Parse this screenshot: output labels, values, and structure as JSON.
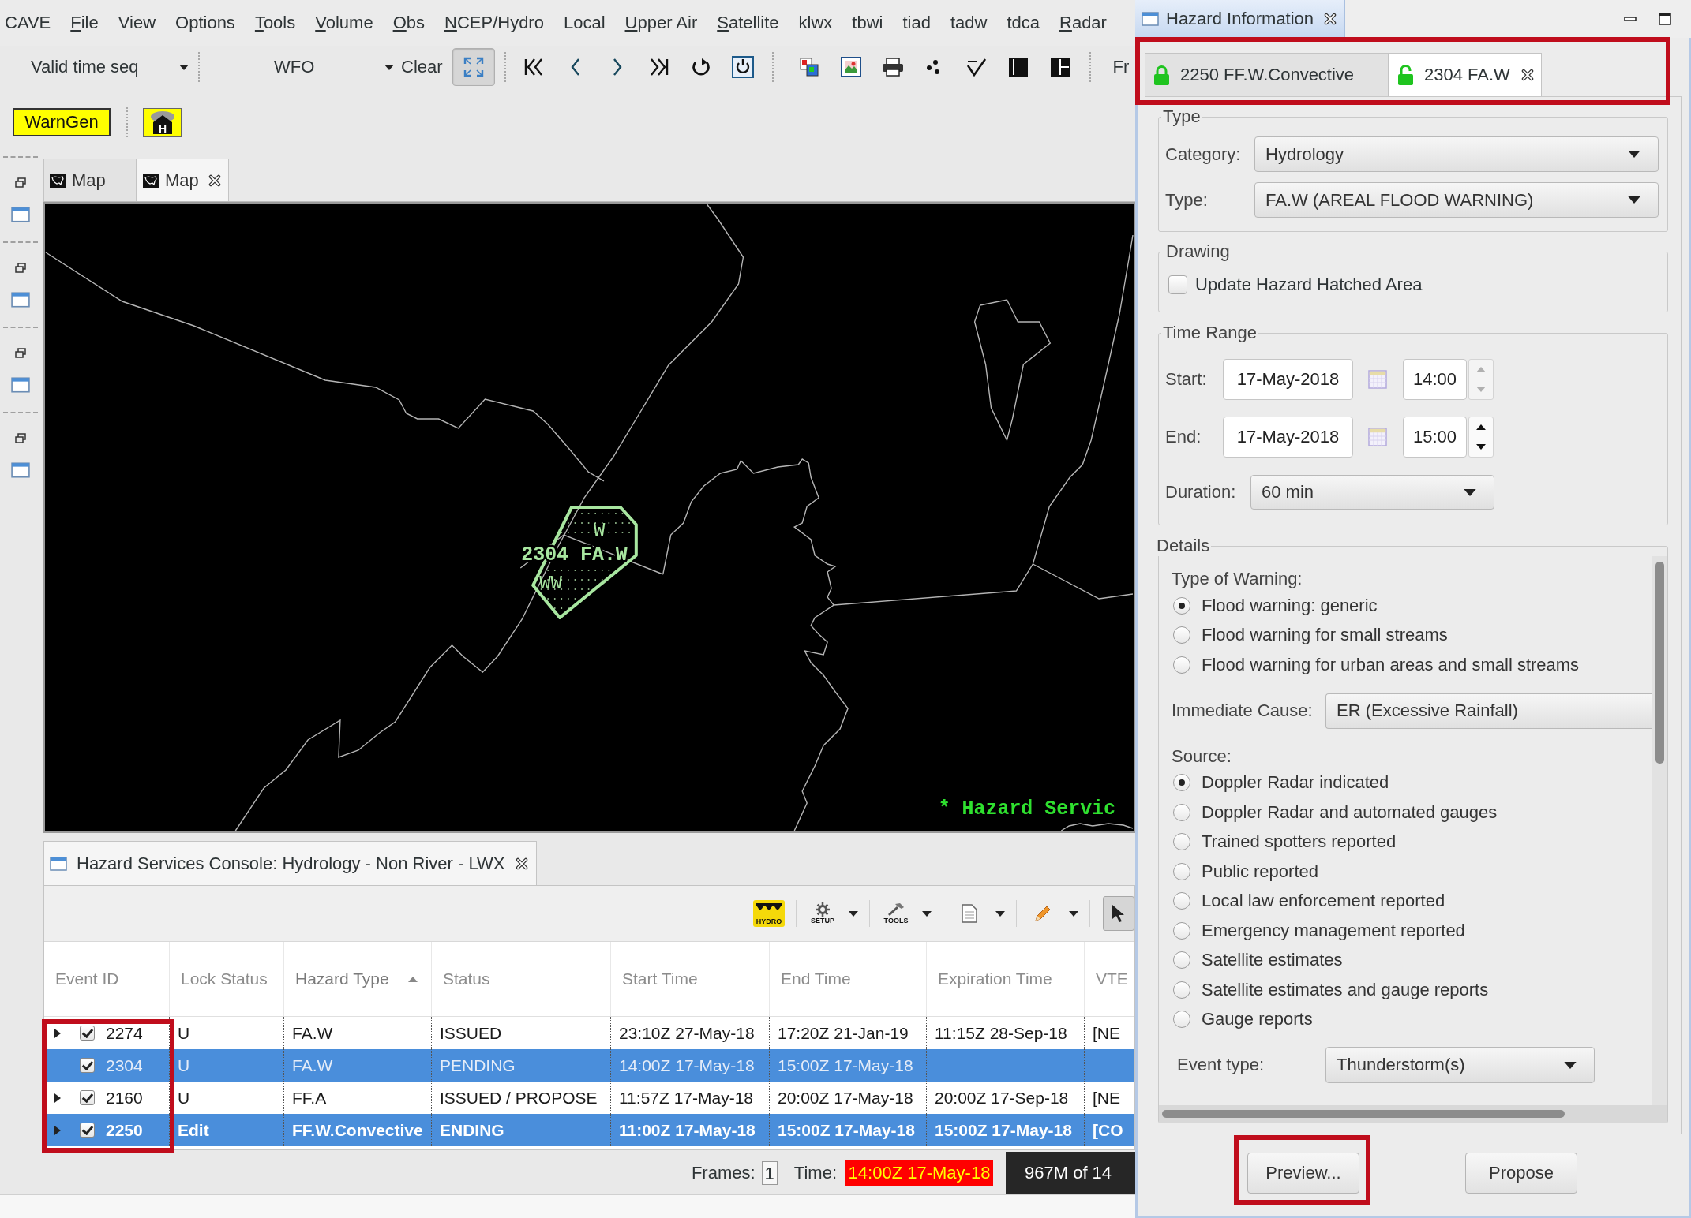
{
  "menu": [
    {
      "label": "CAVE",
      "mnemonic": false
    },
    {
      "label": "File",
      "mnemonic": true
    },
    {
      "label": "View",
      "mnemonic": false
    },
    {
      "label": "Options",
      "mnemonic": false
    },
    {
      "label": "Tools",
      "mnemonic": true
    },
    {
      "label": "Volume",
      "mnemonic": true
    },
    {
      "label": "Obs",
      "mnemonic": true
    },
    {
      "label": "NCEP/Hydro",
      "mnemonic": true
    },
    {
      "label": "Local",
      "mnemonic": false
    },
    {
      "label": "Upper Air",
      "mnemonic": true
    },
    {
      "label": "Satellite",
      "mnemonic": true
    },
    {
      "label": "klwx",
      "mnemonic": false
    },
    {
      "label": "tbwi",
      "mnemonic": false
    },
    {
      "label": "tiad",
      "mnemonic": false
    },
    {
      "label": "tadw",
      "mnemonic": false
    },
    {
      "label": "tdca",
      "mnemonic": false
    },
    {
      "label": "Radar",
      "mnemonic": true
    }
  ],
  "toolbar": {
    "time_mode": "Valid time seq",
    "scale": "WFO",
    "clear": "Clear",
    "extent_pressed": true,
    "overflow_label": "Fr"
  },
  "tools_bar": {
    "warngen": "WarnGen",
    "hazard_glyph": "H"
  },
  "editor_tabs": [
    {
      "label": "Map",
      "selected": false
    },
    {
      "label": "Map",
      "selected": true
    }
  ],
  "map": {
    "hazard_label": "2304 FA.W",
    "hatch_marks": [
      "W",
      "WW"
    ],
    "legend": "* Hazard Servic"
  },
  "console": {
    "title": "Hazard Services Console: Hydrology - Non River - LWX",
    "toolbar": [
      {
        "kind": "hydro",
        "label": "HYDRO",
        "menu": false,
        "pressed": false
      },
      {
        "kind": "setup",
        "label": "SETUP",
        "menu": true,
        "pressed": false
      },
      {
        "kind": "tools",
        "label": "TOOLS",
        "menu": true,
        "pressed": false
      },
      {
        "kind": "document",
        "menu": true,
        "pressed": false
      },
      {
        "kind": "pencil",
        "menu": true,
        "pressed": false
      },
      {
        "kind": "pointer",
        "menu": false,
        "pressed": true
      }
    ],
    "columns": [
      {
        "label": "Event ID",
        "sorted": false
      },
      {
        "label": "Lock Status",
        "sorted": false
      },
      {
        "label": "Hazard Type",
        "sorted": true
      },
      {
        "label": "Status",
        "sorted": false
      },
      {
        "label": "Start Time",
        "sorted": false
      },
      {
        "label": "End Time",
        "sorted": false
      },
      {
        "label": "Expiration Time",
        "sorted": false
      },
      {
        "label": "VTE",
        "sorted": false
      }
    ],
    "rows": [
      {
        "expandable": true,
        "checked": true,
        "selected": false,
        "bold": false,
        "cells": [
          "2274",
          "U",
          "FA.W",
          "ISSUED",
          "23:10Z 27-May-18",
          "17:20Z 21-Jan-19",
          "11:15Z 28-Sep-18",
          "[NE"
        ]
      },
      {
        "expandable": false,
        "checked": true,
        "selected": true,
        "bold": false,
        "cells": [
          "2304",
          "U",
          "FA.W",
          "PENDING",
          "14:00Z 17-May-18",
          "15:00Z 17-May-18"
        ]
      },
      {
        "expandable": true,
        "checked": true,
        "selected": false,
        "bold": false,
        "cells": [
          "2160",
          "U",
          "FF.A",
          "ISSUED / PROPOSE",
          "11:57Z 17-May-18",
          "20:00Z 17-May-18",
          "20:00Z 17-Sep-18",
          "[NE"
        ]
      },
      {
        "expandable": true,
        "checked": true,
        "selected": true,
        "bold": true,
        "cells": [
          "2250",
          "Edit",
          "FF.W.Convective",
          "ENDING",
          "11:00Z 17-May-18",
          "15:00Z 17-May-18",
          "15:00Z 17-May-18",
          "[CO"
        ]
      }
    ],
    "event_ids_highlighted": true
  },
  "status_bar": {
    "frames_label": "Frames:",
    "frames": "1",
    "time_label": "Time:",
    "time": "14:00Z 17-May-18",
    "memory": "967M of 14"
  },
  "hazard_information": {
    "title": "Hazard Information",
    "tabs": [
      {
        "label": "2250 FF.W.Convective",
        "locked": true,
        "selected": false,
        "closable": false
      },
      {
        "label": "2304 FA.W",
        "locked": false,
        "selected": true,
        "closable": true
      }
    ],
    "tabs_highlighted": true,
    "type": {
      "title": "Type",
      "category_label": "Category:",
      "category": "Hydrology",
      "type_label": "Type:",
      "type": "FA.W (AREAL FLOOD WARNING)"
    },
    "drawing": {
      "title": "Drawing",
      "label": "Update Hazard Hatched Area",
      "checked": false
    },
    "time_range": {
      "title": "Time Range",
      "rows": [
        {
          "label": "Start:",
          "date": "17-May-2018",
          "time": "14:00",
          "spinner_enabled": false
        },
        {
          "label": "End:",
          "date": "17-May-2018",
          "time": "15:00",
          "spinner_enabled": true
        }
      ],
      "duration_label": "Duration:",
      "duration": "60 min"
    },
    "details": {
      "title": "Details",
      "warning_label": "Type of Warning:",
      "warnings": [
        {
          "label": "Flood warning: generic",
          "selected": true
        },
        {
          "label": "Flood warning for small streams",
          "selected": false
        },
        {
          "label": "Flood warning for urban areas and small streams",
          "selected": false
        }
      ],
      "cause_label": "Immediate Cause:",
      "cause": "ER (Excessive Rainfall)",
      "source_label": "Source:",
      "sources": [
        {
          "label": "Doppler Radar indicated",
          "selected": true
        },
        {
          "label": "Doppler Radar and automated gauges",
          "selected": false
        },
        {
          "label": "Trained spotters reported",
          "selected": false
        },
        {
          "label": "Public reported",
          "selected": false
        },
        {
          "label": "Local law enforcement reported",
          "selected": false
        },
        {
          "label": "Emergency management reported",
          "selected": false
        },
        {
          "label": "Satellite estimates",
          "selected": false
        },
        {
          "label": "Satellite estimates and gauge reports",
          "selected": false
        },
        {
          "label": "Gauge reports",
          "selected": false
        }
      ],
      "event_type_label": "Event type:",
      "event_type": "Thunderstorm(s)"
    },
    "buttons": [
      {
        "label": "Preview...",
        "highlighted": true
      },
      {
        "label": "Propose",
        "highlighted": false
      }
    ]
  }
}
